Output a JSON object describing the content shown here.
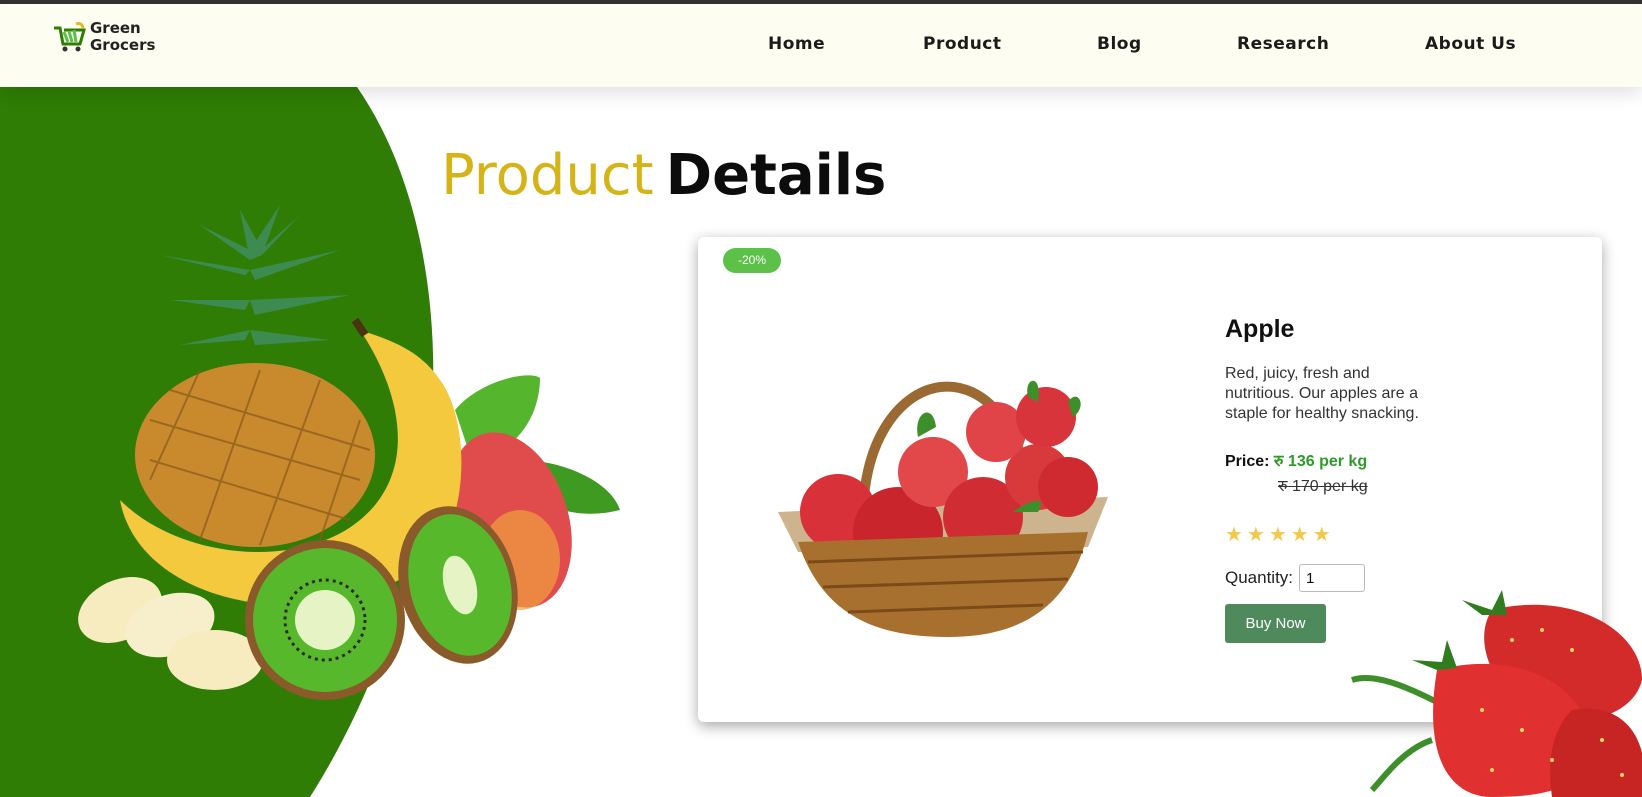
{
  "brand": {
    "line1": "Green",
    "line2": "Grocers"
  },
  "nav": [
    {
      "label": "Home"
    },
    {
      "label": "Product"
    },
    {
      "label": "Blog"
    },
    {
      "label": "Research"
    },
    {
      "label": "About Us"
    }
  ],
  "title": {
    "part1": "Product",
    "part2": "Details"
  },
  "product": {
    "badge": "-20%",
    "name": "Apple",
    "description": "Red, juicy, fresh and nutritious. Our apples are a staple for healthy snacking.",
    "price_label": "Price:",
    "price_new": "रु 136 per kg",
    "price_old": "रु 170 per kg",
    "rating_stars": "★★★★★",
    "rating": 5,
    "quantity_label": "Quantity:",
    "quantity_value": "1",
    "buy_label": "Buy Now"
  },
  "colors": {
    "header_bg": "#fdfdf2",
    "green_bg": "#2f7d05",
    "title_accent": "#d6b417",
    "price_green": "#2e9a2a",
    "badge_green": "#5cc148",
    "button_green": "#4f8a5c"
  }
}
